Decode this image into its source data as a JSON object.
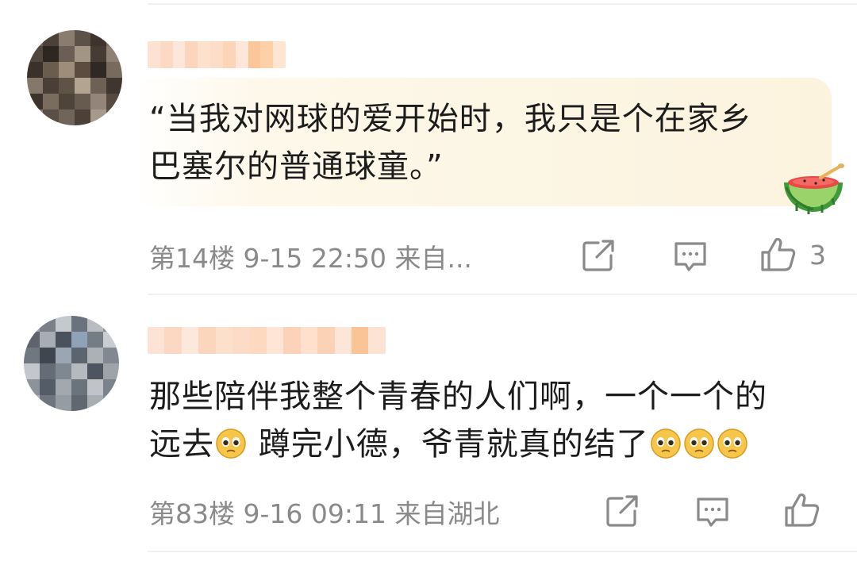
{
  "comments": [
    {
      "avatar_colors": [
        "#6e6358",
        "#4c4038",
        "#8a7d70",
        "#5d5248",
        "#3e342d",
        "#7b6f63",
        "#51473f",
        "#2e2620",
        "#6b5f55",
        "#a39584",
        "#463c34",
        "#8f8275",
        "#3a312a",
        "#6a5c4e",
        "#9e8d7b",
        "#5b4c3f",
        "#302822",
        "#786a5d",
        "#85786b",
        "#4a3f36",
        "#5f5247",
        "#b3a491",
        "#6d6054",
        "#403630",
        "#3c332c",
        "#7a6c5f",
        "#4f443a",
        "#675a4e",
        "#93857a",
        "#564a40",
        "#8b7f73",
        "#5a4f46",
        "#716458",
        "#4b4139",
        "#a69a8d",
        "#625649"
      ],
      "name_colors": [
        "#fde2d3",
        "#fcd9c4",
        "#fde7db",
        "#fbd6bd",
        "#fce1cd",
        "#fdddc8",
        "#fcd5b9",
        "#fee6d8",
        "#fbc79a",
        "#fdd0a8",
        "#fde5d2"
      ],
      "text_line1": "“当我对网球的爱开始时，我只是个在家乡",
      "text_line2": "巴塞尔的普通球童。”",
      "meta": "第14楼 9-15 22:50 来自...",
      "like_count": "3",
      "sticker_icon": "watermelon-icon",
      "icons": {
        "share": "share-icon",
        "reply": "comment-icon",
        "like": "thumbs-up-icon"
      }
    },
    {
      "avatar_colors": [
        "#9da3ab",
        "#7b8088",
        "#c5c8cc",
        "#6a727d",
        "#b9bcc1",
        "#8a9099",
        "#5d646e",
        "#a7adb5",
        "#4a525d",
        "#8fa2b8",
        "#747c86",
        "#c9ccd0",
        "#6f7780",
        "#3f4650",
        "#9aa6b3",
        "#5a6570",
        "#adb1b6",
        "#818891",
        "#c3c6ca",
        "#646c76",
        "#7f8892",
        "#b6babf",
        "#4d5560",
        "#9ea3a9",
        "#8c939b",
        "#545c67",
        "#a2a8ae",
        "#6b737c",
        "#c0c3c7",
        "#7a828b",
        "#b0b4b9",
        "#6e757e",
        "#959ca3",
        "#5f6771",
        "#a9aeb3",
        "#858c94"
      ],
      "name_colors": [
        "#fde3d5",
        "#fcd8c3",
        "#fde8dc",
        "#fbd5bc",
        "#fde0cc",
        "#fcdcc6",
        "#fdd9c0",
        "#fee5d6",
        "#fcd3b8",
        "#fde1cd",
        "#fbd2b5",
        "#fde6d7",
        "#fbc497",
        "#fde3d3"
      ],
      "text_line1": "那些陪伴我整个青春的人们啊，一个一个的",
      "text_line2a": "远去",
      "text_line2b": " 蹲完小德，爷青就真的结了",
      "meta": "第83楼 9-16 09:11 来自湖北",
      "emoji_icon": "pleading-face-emoji",
      "icons": {
        "share": "share-icon",
        "reply": "comment-icon",
        "like": "thumbs-up-icon"
      }
    }
  ],
  "colors": {
    "text": "#1c1c1c",
    "meta": "#8a8a8a",
    "icon": "#8a8a8a",
    "bubble": "#fcf3de",
    "emoji_face": "#f6c64a"
  }
}
